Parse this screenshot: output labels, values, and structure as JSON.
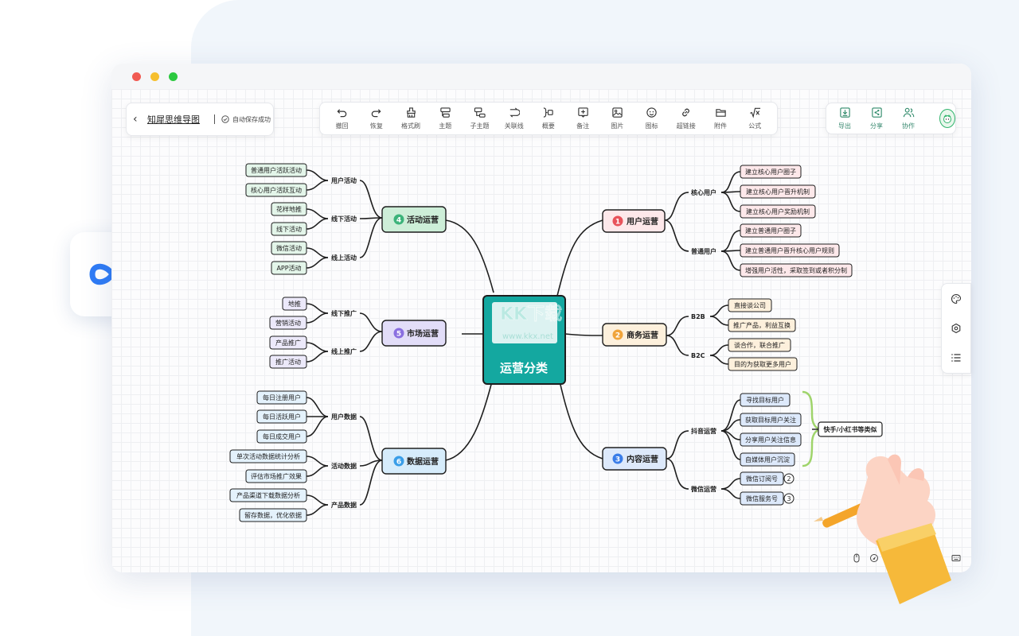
{
  "file": {
    "name": "知犀思维导图",
    "save_status": "自动保存成功"
  },
  "toolbar": [
    {
      "label": "撤回",
      "icon": "undo-icon"
    },
    {
      "label": "恢复",
      "icon": "redo-icon"
    },
    {
      "label": "格式刷",
      "icon": "format-brush-icon"
    },
    {
      "label": "主题",
      "icon": "topic-icon"
    },
    {
      "label": "子主题",
      "icon": "subtopic-icon"
    },
    {
      "label": "关联线",
      "icon": "relation-line-icon"
    },
    {
      "label": "概要",
      "icon": "summary-icon"
    },
    {
      "label": "备注",
      "icon": "note-icon"
    },
    {
      "label": "图片",
      "icon": "image-icon"
    },
    {
      "label": "图标",
      "icon": "emoji-icon"
    },
    {
      "label": "超链接",
      "icon": "link-icon"
    },
    {
      "label": "附件",
      "icon": "folder-icon"
    },
    {
      "label": "公式",
      "icon": "formula-icon"
    }
  ],
  "actions": [
    {
      "label": "导出",
      "icon": "export-icon"
    },
    {
      "label": "分享",
      "icon": "share-icon"
    },
    {
      "label": "协作",
      "icon": "collaborate-icon"
    }
  ],
  "watermark": {
    "title": "KK下载",
    "url": "www.kkx.net"
  },
  "mindmap": {
    "center": "运营分类",
    "branches": {
      "b1": {
        "num": "1",
        "label": "用户运营",
        "color": "#e8525a",
        "subs": [
          {
            "label": "核心用户",
            "leaves": [
              "建立核心用户圈子",
              "建立核心用户晋升机制",
              "建立核心用户奖励机制"
            ]
          },
          {
            "label": "普通用户",
            "leaves": [
              "建立普通用户圈子",
              "建立普通用户晋升核心用户规则",
              "增强用户活性，采取签到或者积分制"
            ]
          }
        ]
      },
      "b2": {
        "num": "2",
        "label": "商务运营",
        "color": "#f0a43a",
        "subs": [
          {
            "label": "B2B",
            "leaves": [
              "直接谈公司",
              "推广产品，利益互换"
            ]
          },
          {
            "label": "B2C",
            "leaves": [
              "谈合作，联合推广",
              "目的为获取更多用户"
            ]
          }
        ]
      },
      "b3": {
        "num": "3",
        "label": "内容运营",
        "color": "#3a7de8",
        "subs": [
          {
            "label": "抖音运营",
            "leaves": [
              "寻找目标用户",
              "获取目标用户关注",
              "分享用户关注信息",
              "自媒体用户沉淀"
            ]
          },
          {
            "label": "微信运营",
            "leaves": [
              "微信订阅号",
              "微信服务号"
            ]
          }
        ],
        "summary": "快手/小红书等类似",
        "leaf_badges": [
          "2",
          "3"
        ]
      },
      "b4": {
        "num": "4",
        "label": "活动运营",
        "color": "#3cb37a",
        "subs": [
          {
            "label": "用户活动",
            "leaves": [
              "普通用户活跃活动",
              "核心用户活跃互动"
            ]
          },
          {
            "label": "线下活动",
            "leaves": [
              "花样地推",
              "线下活动"
            ]
          },
          {
            "label": "线上活动",
            "leaves": [
              "微信活动",
              "APP活动"
            ]
          }
        ]
      },
      "b5": {
        "num": "5",
        "label": "市场运营",
        "color": "#8a6fe0",
        "subs": [
          {
            "label": "线下推广",
            "leaves": [
              "地推",
              "营销活动"
            ]
          },
          {
            "label": "线上推广",
            "leaves": [
              "产品推广",
              "推广活动"
            ]
          }
        ]
      },
      "b6": {
        "num": "6",
        "label": "数据运营",
        "color": "#3a9ee8",
        "subs": [
          {
            "label": "用户数据",
            "leaves": [
              "每日注册用户",
              "每日活跃用户",
              "每日成交用户"
            ]
          },
          {
            "label": "活动数据",
            "leaves": [
              "单次活动数据统计分析",
              "评估市场推广效果"
            ]
          },
          {
            "label": "产品数据",
            "leaves": [
              "产品渠道下载数据分析",
              "留存数据，优化依据"
            ]
          }
        ]
      }
    }
  }
}
